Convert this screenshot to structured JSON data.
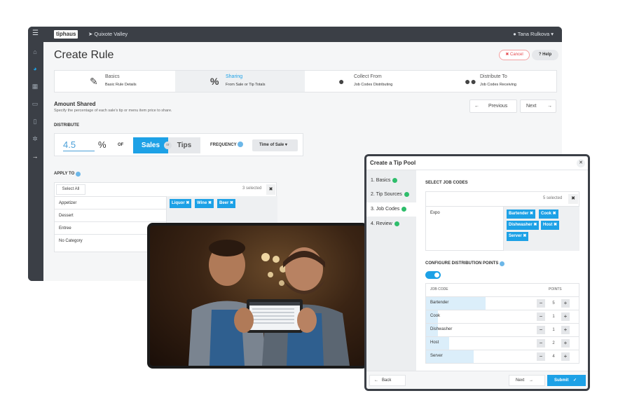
{
  "topbar": {
    "logo": "tiphaus",
    "location": "Quixote Valley",
    "user": "Tana Rulkova"
  },
  "page": {
    "title": "Create Rule",
    "cancel_label": "✖ Cancel",
    "help_label": "? Help"
  },
  "steps": [
    {
      "title": "Basics",
      "subtitle": "Basic Rule Details",
      "icon": "edit-check-icon"
    },
    {
      "title": "Sharing",
      "subtitle": "From Sale or Tip Totals",
      "icon": "percent-icon"
    },
    {
      "title": "Collect From",
      "subtitle": "Job Codes Distributing",
      "icon": "person-icon"
    },
    {
      "title": "Distribute To",
      "subtitle": "Job Codes Receiving",
      "icon": "people-icon"
    }
  ],
  "amount": {
    "heading": "Amount Shared",
    "subtitle": "Specify the percentage of each sale's tip or menu item price to share."
  },
  "nav": {
    "previous": "Previous",
    "next": "Next"
  },
  "distribute": {
    "heading": "DISTRIBUTE",
    "value": "4.5",
    "percent": "%",
    "of": "OF",
    "sales": "Sales",
    "or": "or",
    "tips": "Tips",
    "frequency_label": "FREQUENCY",
    "frequency_value": "Time of Sale"
  },
  "apply": {
    "heading": "APPLY TO",
    "select_all": "Select All",
    "selected": "3 selected",
    "categories": [
      "Appetizer",
      "Dessert",
      "Entree",
      "No Category"
    ],
    "tags": [
      "Liquor ✖",
      "Wine ✖",
      "Beer ✖"
    ]
  },
  "pool": {
    "title": "Create a Tip Pool",
    "steps": [
      "1. Basics",
      "2. Tip Sources",
      "3. Job Codes",
      "4. Review"
    ],
    "select_heading": "SELECT JOB CODES",
    "selected": "5 selected",
    "available": [
      "Expo"
    ],
    "tags": [
      "Bartender ✖",
      "Cook ✖",
      "Dishwasher ✖",
      "Host ✖",
      "Server ✖"
    ],
    "config_heading": "CONFIGURE DISTRIBUTION POINTS",
    "col_job": "JOB CODE",
    "col_points": "POINTS",
    "rows": [
      {
        "name": "Bartender",
        "points": "5",
        "share": 0.39
      },
      {
        "name": "Cook",
        "points": "1",
        "share": 0.08
      },
      {
        "name": "Dishwasher",
        "points": "1",
        "share": 0.08
      },
      {
        "name": "Host",
        "points": "2",
        "share": 0.15
      },
      {
        "name": "Server",
        "points": "4",
        "share": 0.31
      }
    ],
    "back": "Back",
    "next": "Next",
    "submit": "Submit"
  },
  "colors": {
    "accent": "#1da1e6",
    "success": "#2ebd6b",
    "danger": "#e5484d",
    "chrome": "#3b3f46"
  }
}
